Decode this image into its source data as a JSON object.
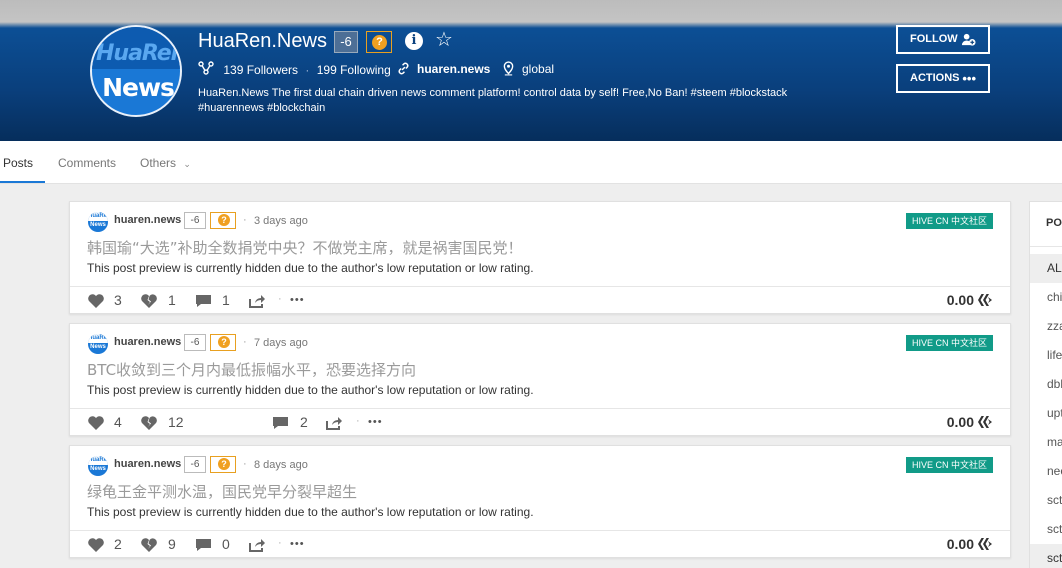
{
  "profile": {
    "avatar_line1": "HuaRen",
    "avatar_line2": "News",
    "name": "HuaRen.News",
    "reputation": "-6",
    "question_badge": "?",
    "info_glyph": "i",
    "followers": "139 Followers",
    "following": "199 Following",
    "website": "huaren.news",
    "location": "global",
    "about": "HuaRen.News The first dual chain driven news comment platform! control data by self! Free,No Ban! #steem #blockstack #huarennews #blockchain",
    "follow_label": "FOLLOW",
    "actions_label": "ACTIONS"
  },
  "tabs": [
    {
      "label": "Posts",
      "active": true
    },
    {
      "label": "Comments",
      "active": false
    },
    {
      "label": "Others",
      "active": false
    }
  ],
  "posts": [
    {
      "author": "huaren.news",
      "reputation": "-6",
      "time": "3 days ago",
      "community": "HIVE CN 中文社区",
      "title": "韩国瑜“大选”补助全数捐党中央？不做党主席，就是祸害国民党！",
      "preview": "This post preview is currently hidden due to the author's low reputation or low rating.",
      "upvotes": "3",
      "downvotes": "1",
      "comments": "1",
      "payout": "0.00"
    },
    {
      "author": "huaren.news",
      "reputation": "-6",
      "time": "7 days ago",
      "community": "HIVE CN 中文社区",
      "title": "BTC收敛到三个月内最低振幅水平，恐要选择方向",
      "preview": "This post preview is currently hidden due to the author's low reputation or low rating.",
      "upvotes": "4",
      "downvotes": "12",
      "comments": "2",
      "payout": "0.00"
    },
    {
      "author": "huaren.news",
      "reputation": "-6",
      "time": "8 days ago",
      "community": "HIVE CN 中文社区",
      "title": "绿龟王金平测水温，国民党早分裂早超生",
      "preview": "This post preview is currently hidden due to the author's low reputation or low rating.",
      "upvotes": "2",
      "downvotes": "9",
      "comments": "0",
      "payout": "0.00"
    }
  ],
  "sidebar": {
    "header": "POS",
    "items": [
      "ALL",
      "chi",
      "zza",
      "life",
      "dbl",
      "upt",
      "ma",
      "nec",
      "sct",
      "sct",
      "sct"
    ]
  },
  "mini_avatar": {
    "line1": "HuaRen",
    "line2": "News"
  },
  "colors": {
    "banner": "#0a3f7c",
    "community": "#119b88",
    "accent": "#1a78d6",
    "warning": "#f0a020"
  }
}
